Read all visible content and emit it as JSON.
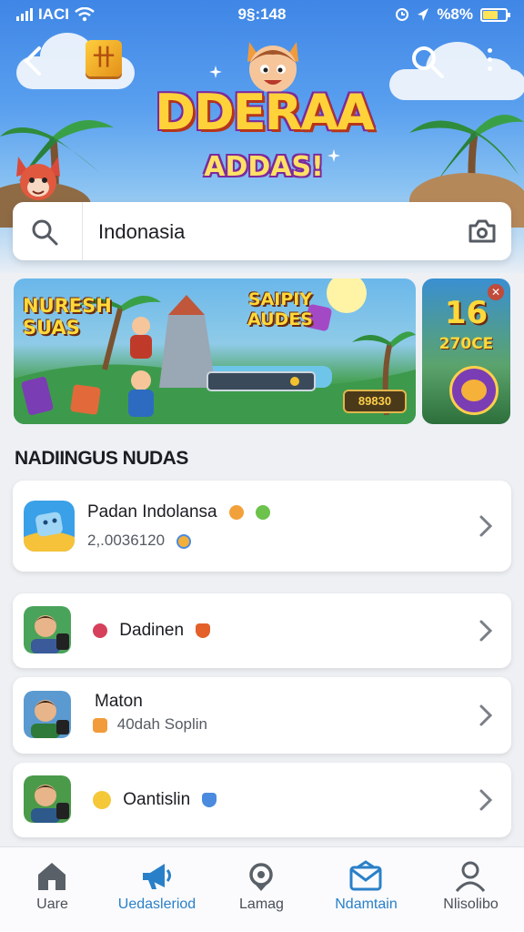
{
  "status_bar": {
    "carrier": "IACI",
    "time": "9§:148",
    "battery": "%8%"
  },
  "header": {
    "logo_glyph": "卄",
    "title_line1": "DDERAA",
    "title_line2": "ADDAS!"
  },
  "search": {
    "value": "Indonasia"
  },
  "banner_main": {
    "left_title": "NURESH SUAS",
    "right_title": "SAIPIY AUDES",
    "price": "89830"
  },
  "banner_side": {
    "number": "16",
    "subtitle": "270CE"
  },
  "section": {
    "title": "NADIINGUS NUDAS"
  },
  "list": [
    {
      "name": "Padan Indolansa",
      "sub": "2,.0036120"
    },
    {
      "name": "Dadinen",
      "sub": ""
    },
    {
      "name": "Maton",
      "sub": "40dah Soplin"
    },
    {
      "name": "Oantislin",
      "sub": ""
    }
  ],
  "nav": [
    {
      "label": "Uare",
      "icon": "home-icon"
    },
    {
      "label": "Uedasleriod",
      "icon": "megaphone-icon"
    },
    {
      "label": "Lamag",
      "icon": "search-location-icon"
    },
    {
      "label": "Ndamtain",
      "icon": "mail-icon"
    },
    {
      "label": "Nlisolibo",
      "icon": "profile-icon"
    }
  ],
  "colors": {
    "accent": "#2a80c8",
    "header_top": "#3f86e6"
  }
}
